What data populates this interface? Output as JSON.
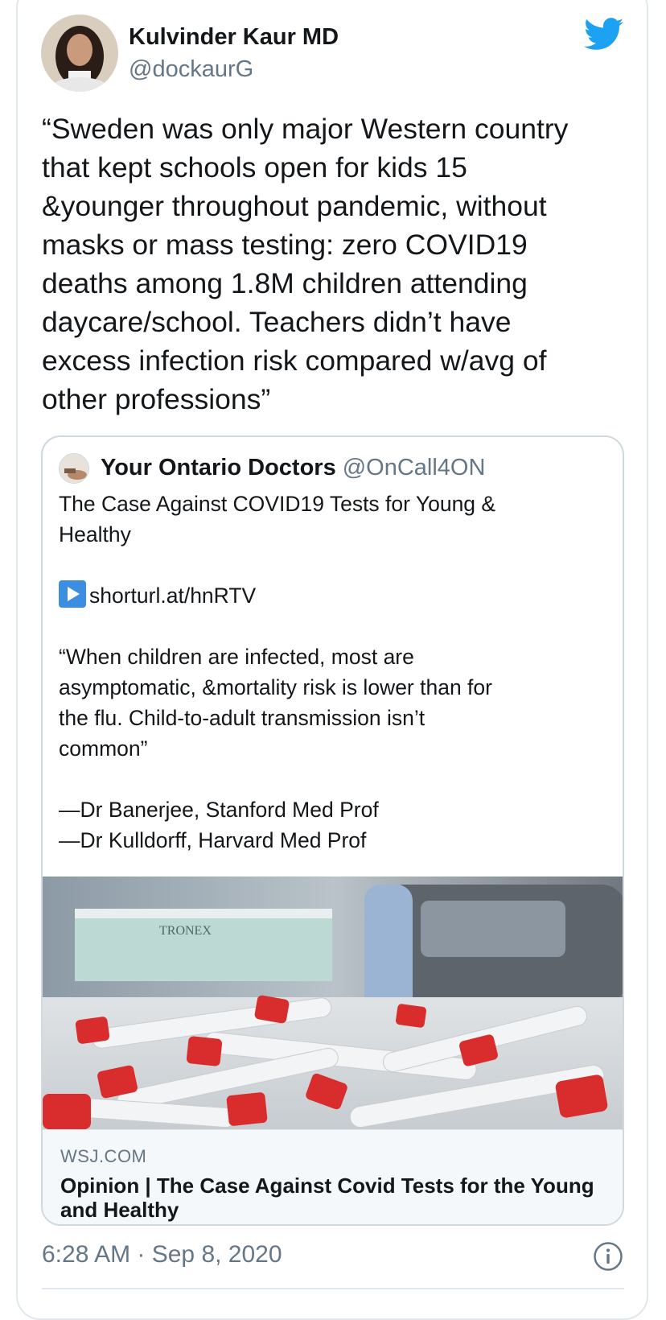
{
  "author": {
    "name": "Kulvinder Kaur MD",
    "handle": "@dockaurG"
  },
  "tweet": {
    "lines": [
      "“Sweden was only major Western country",
      "that kept schools open for kids 15",
      "&younger throughout pandemic, without",
      "masks or mass testing: zero COVID19",
      "deaths among 1.8M children attending",
      "daycare/school. Teachers didn’t have",
      "excess infection risk compared w/avg of",
      "other professions”"
    ]
  },
  "quoted": {
    "name": "Your Ontario Doctors",
    "handle": "@OnCall4ON",
    "lines": [
      "The Case Against COVID19 Tests for Young &",
      "Healthy",
      "",
      "shorturl.at/hnRTV",
      "",
      "“When children are infected, most are",
      "asymptomatic, &mortality risk is lower than for",
      "the flu. Child-to-adult transmission isn’t",
      "common”",
      "",
      "—Dr Banerjee, Stanford Med Prof",
      "—Dr Kulldorff, Harvard Med Prof"
    ],
    "card": {
      "domain": "WSJ.COM",
      "title": "Opinion | The Case Against Covid Tests for the Young and Healthy",
      "photo_text": "TRONEX"
    }
  },
  "timestamp": "6:28 AM · Sep 8, 2020",
  "colors": {
    "twitter_blue": "#1da1f2",
    "secondary_text": "#657786",
    "border": "#e1e8ed"
  },
  "icons": {
    "brand": "twitter-bird-icon",
    "info": "info-icon",
    "link": "play-button-icon"
  }
}
